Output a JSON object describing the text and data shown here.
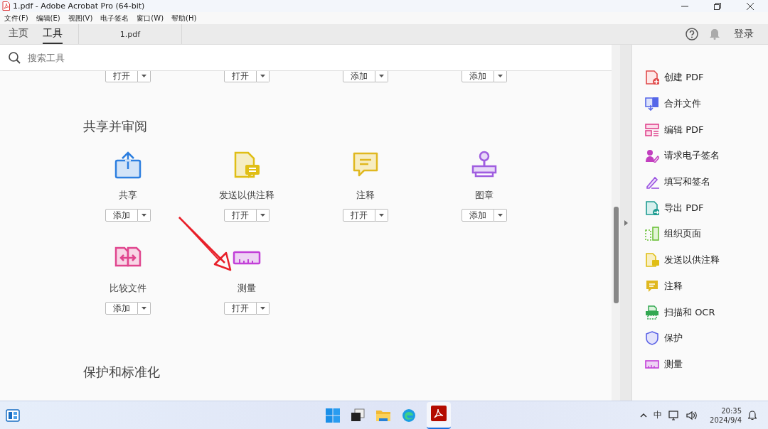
{
  "window": {
    "title": "1.pdf - Adobe Acrobat Pro (64-bit)"
  },
  "menu": [
    "文件(F)",
    "编辑(E)",
    "视图(V)",
    "电子签名",
    "窗口(W)",
    "帮助(H)"
  ],
  "tabs": [
    {
      "label": "主页",
      "selected": false
    },
    {
      "label": "工具",
      "selected": true
    }
  ],
  "document_tab": "1.pdf",
  "login": "登录",
  "search": {
    "placeholder": "搜索工具"
  },
  "top_buttons": [
    "打开",
    "打开",
    "添加",
    "添加"
  ],
  "sections": [
    {
      "title": "共享并审阅",
      "tools": [
        {
          "kind": "share",
          "name": "共享",
          "button": "添加"
        },
        {
          "kind": "send",
          "name": "发送以供注释",
          "button": "打开"
        },
        {
          "kind": "comment",
          "name": "注释",
          "button": "打开"
        },
        {
          "kind": "stamp",
          "name": "图章",
          "button": "添加"
        },
        {
          "kind": "compare",
          "name": "比较文件",
          "button": "添加"
        },
        {
          "kind": "measure",
          "name": "测量",
          "button": "打开"
        }
      ]
    },
    {
      "title": "保护和标准化"
    }
  ],
  "right_panel": [
    {
      "kind": "create",
      "label": "创建 PDF"
    },
    {
      "kind": "combine",
      "label": "合并文件"
    },
    {
      "kind": "edit",
      "label": "编辑 PDF"
    },
    {
      "kind": "request",
      "label": "请求电子签名"
    },
    {
      "kind": "fill",
      "label": "填写和签名"
    },
    {
      "kind": "export",
      "label": "导出 PDF"
    },
    {
      "kind": "organize",
      "label": "组织页面"
    },
    {
      "kind": "send",
      "label": "发送以供注释"
    },
    {
      "kind": "comment",
      "label": "注释"
    },
    {
      "kind": "scan",
      "label": "扫描和 OCR"
    },
    {
      "kind": "protect",
      "label": "保护"
    },
    {
      "kind": "measure",
      "label": "测量"
    }
  ],
  "taskbar": {
    "input_method": "中",
    "time": "20:35",
    "date": "2024/9/4"
  }
}
